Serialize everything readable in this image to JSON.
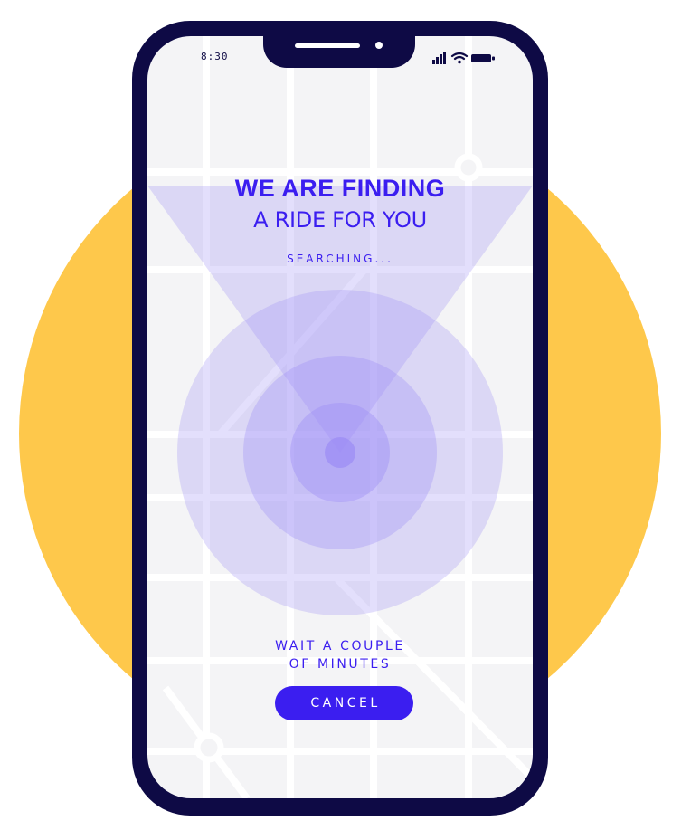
{
  "status_bar": {
    "time": "8:30",
    "icons": [
      "signal-icon",
      "wifi-icon",
      "battery-icon"
    ]
  },
  "main": {
    "title_bold": "WE ARE FINDING",
    "title_light": "A RIDE FOR YOU",
    "status_text": "SEARCHING...",
    "wait_line_1": "WAIT A COUPLE",
    "wait_line_2": "OF MINUTES",
    "cancel_label": "CANCEL"
  },
  "colors": {
    "accent": "#3B1EF0",
    "phone_frame": "#0E0A45",
    "backdrop": "#FEC84B",
    "map_background": "#F4F4F6",
    "radar": "#9B8CF5"
  }
}
